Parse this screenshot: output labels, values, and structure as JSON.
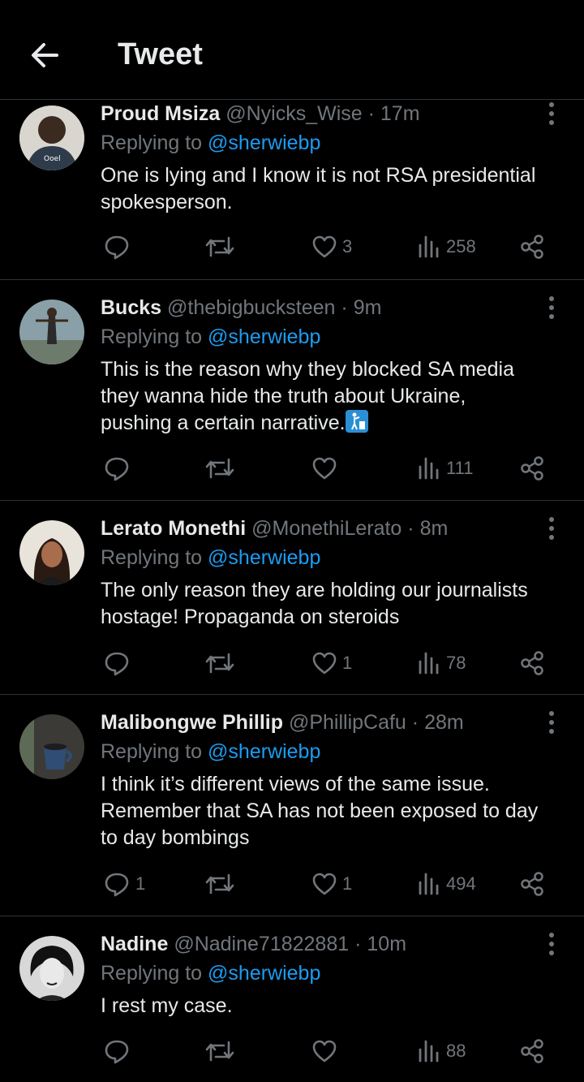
{
  "header": {
    "title": "Tweet"
  },
  "tweets": [
    {
      "name": "Proud Msiza",
      "handle": "@Nyicks_Wise",
      "time": "17m",
      "replying_prefix": "Replying to",
      "replying_handle": "@sherwiebp",
      "text_lines": [
        "One is lying and I know it is not RSA presidential",
        "spokesperson."
      ],
      "replies": "",
      "retweets": "",
      "likes": "3",
      "views": "258"
    },
    {
      "name": "Bucks",
      "handle": "@thebigbucksteen",
      "time": "9m",
      "replying_prefix": "Replying to",
      "replying_handle": "@sherwiebp",
      "text_lines": [
        "This is the reason why they blocked SA media",
        "they wanna hide the truth about Ukraine,",
        "pushing a certain narrative."
      ],
      "replies": "",
      "retweets": "",
      "likes": "",
      "views": "111"
    },
    {
      "name": "Lerato Monethi",
      "handle": "@MonethiLerato",
      "time": "8m",
      "replying_prefix": "Replying to",
      "replying_handle": "@sherwiebp",
      "text_lines": [
        "The only reason they are holding our journalists",
        "hostage! Propaganda on steroids"
      ],
      "replies": "",
      "retweets": "",
      "likes": "1",
      "views": "78"
    },
    {
      "name": "Malibongwe Phillip",
      "handle": "@PhillipCafu",
      "time": "28m",
      "replying_prefix": "Replying to",
      "replying_handle": "@sherwiebp",
      "text_lines": [
        "I think it’s different views of the same issue.",
        "Remember that SA has not been exposed to day",
        "to day bombings"
      ],
      "replies": "1",
      "retweets": "",
      "likes": "1",
      "views": "494"
    },
    {
      "name": "Nadine",
      "handle": "@Nadine71822881",
      "time": "10m",
      "replying_prefix": "Replying to",
      "replying_handle": "@sherwiebp",
      "text_lines": [
        "I rest my case."
      ],
      "replies": "",
      "retweets": "",
      "likes": "",
      "views": "88"
    }
  ],
  "icons": {
    "back": "arrow-left-icon",
    "reply": "speech-bubble-icon",
    "retweet": "retweet-icon",
    "like": "heart-icon",
    "views": "bar-chart-icon",
    "share": "share-nodes-icon",
    "more": "vertical-dots-icon",
    "emoji": "litter-in-bin-emoji"
  },
  "colors": {
    "background": "#000000",
    "text": "#e7e9ea",
    "muted": "#71767b",
    "link": "#1d9bf0",
    "divider": "#2f3336"
  }
}
